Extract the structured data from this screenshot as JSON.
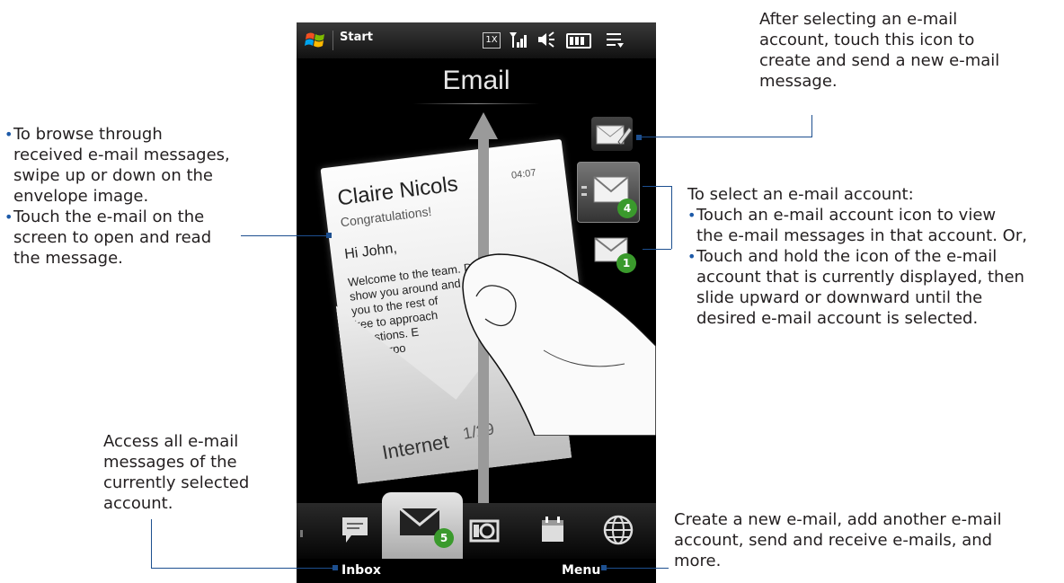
{
  "phone": {
    "status": {
      "start_label": "Start"
    },
    "title": "Email",
    "email": {
      "sender": "Claire Nicols",
      "time": "04:07",
      "subject": "Congratulations!",
      "greeting": "Hi John,",
      "body_lines": [
        "Welcome to the team. Diana will",
        "show you around and introduce",
        "you to the rest of",
        "free to approach",
        "questions. E",
        "our corpo",
        "om"
      ],
      "account_label": "Internet",
      "page": "1/29"
    },
    "accounts": [
      {
        "badge": "4"
      },
      {
        "badge": "1"
      }
    ],
    "tabs": {
      "mail_badge": "5"
    },
    "softkeys": {
      "left": "Inbox",
      "right": "Menu"
    }
  },
  "annotations": {
    "new_mail": [
      "After selecting an e-mail",
      "account, touch this icon to",
      "create and send a new e-mail",
      "message."
    ],
    "browse": {
      "bullets": [
        [
          "To browse through",
          "received e-mail messages,",
          "swipe up or down on the",
          "envelope image."
        ],
        [
          "Touch the e-mail on the",
          "screen to open and read",
          "the message."
        ]
      ]
    },
    "select_account": {
      "heading": "To select an e-mail account:",
      "bullets": [
        [
          "Touch an e-mail account icon to view",
          "the e-mail messages in that account. Or,"
        ],
        [
          "Touch and hold the icon of the e-mail",
          "account that is currently displayed, then",
          "slide upward or downward until the",
          "desired e-mail account is selected."
        ]
      ]
    },
    "inbox": [
      "Access all e-mail",
      "messages of the",
      "currently selected",
      "account."
    ],
    "menu": [
      "Create a new e-mail, add another e-mail",
      "account, send and receive e-mails, and",
      "more."
    ]
  },
  "colors": {
    "callout": "#1d4f8f",
    "badge": "#3a9a2c"
  }
}
